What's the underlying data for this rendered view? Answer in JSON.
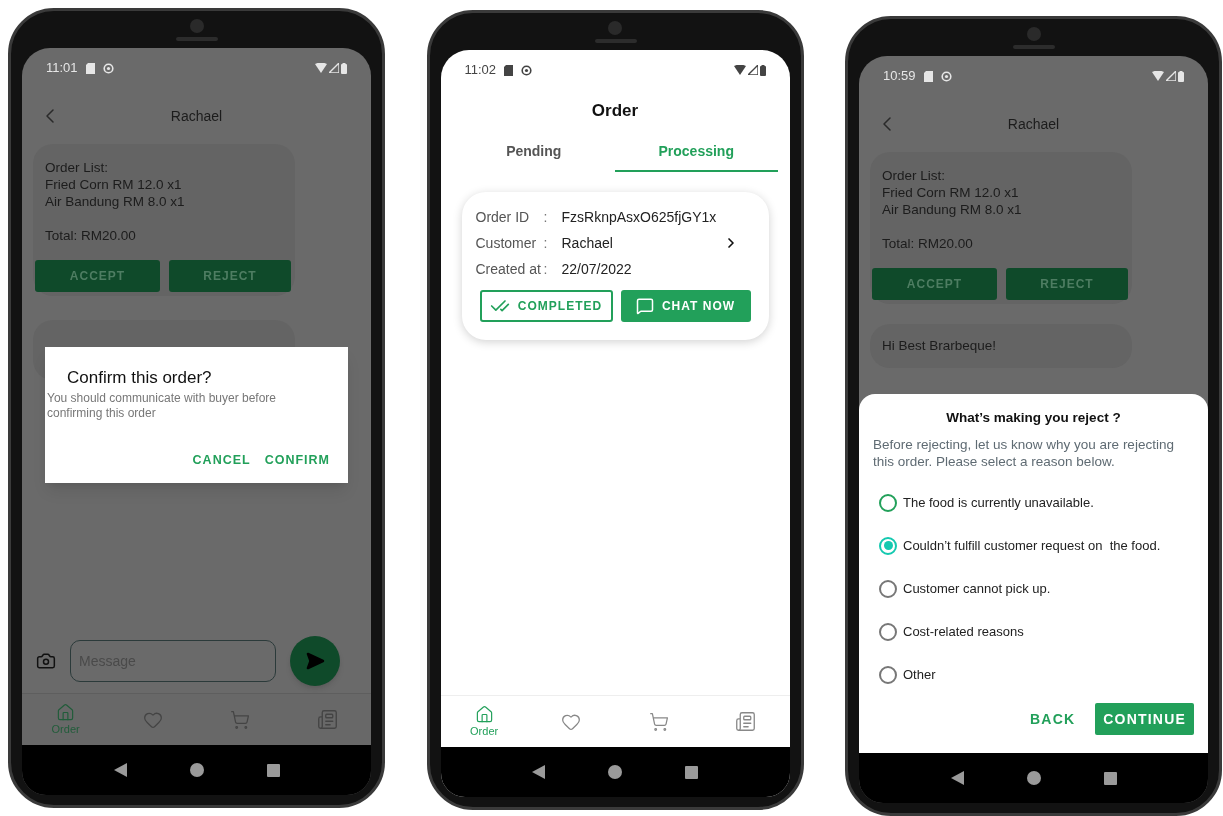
{
  "phones": [
    {
      "kind": "chat",
      "dimmed": true,
      "status_time": "11:01",
      "title": "Rachael",
      "order_card": {
        "lines": [
          "Order List:",
          "Fried Corn RM 12.0 x1",
          "Air Bandung RM 8.0 x1"
        ],
        "total": "Total: RM20.00",
        "buttons": [
          "ACCEPT",
          "REJECT"
        ]
      },
      "covered_bubble": true,
      "message_field": {
        "placeholder": "Message"
      },
      "bottom_nav": [
        {
          "label": "Order",
          "selected": true
        },
        {
          "selected": false
        },
        {
          "selected": false
        },
        {
          "selected": false
        }
      ],
      "dialog": {
        "kind": "confirm",
        "title": "Confirm this order?",
        "body": "You should communicate with buyer before confirming this order",
        "actions": [
          "CANCEL",
          "CONFIRM"
        ]
      }
    },
    {
      "kind": "orders",
      "dimmed": false,
      "status_time": "11:02",
      "title": "Order",
      "tabs": [
        {
          "label": "Pending",
          "selected": false
        },
        {
          "label": "Processing",
          "selected": true
        }
      ],
      "order": {
        "fields": [
          {
            "label": "Order ID",
            "separator": ":",
            "value": "FzsRknpAsxO625fjGY1x"
          },
          {
            "label": "Customer",
            "separator": ":",
            "value": "Rachael",
            "link": true
          },
          {
            "label": "Created at",
            "separator": ":",
            "value": "22/07/2022"
          }
        ],
        "completed_button": "COMPLETED",
        "chat_button": "CHAT NOW"
      },
      "bottom_nav": [
        {
          "label": "Order",
          "selected": true
        },
        {
          "selected": false
        },
        {
          "selected": false
        },
        {
          "selected": false
        }
      ]
    },
    {
      "kind": "chat",
      "dimmed": true,
      "status_time": "10:59",
      "title": "Rachael",
      "order_card": {
        "lines": [
          "Order List:",
          "Fried Corn RM 12.0 x1",
          "Air Bandung RM 8.0 x1"
        ],
        "total": "Total: RM20.00",
        "buttons": [
          "ACCEPT",
          "REJECT"
        ]
      },
      "bubble": "Hi Best Brarbeque!",
      "dialog": {
        "kind": "sheet",
        "title": "What’s making you reject ?",
        "body": "Before rejecting, let us know why you are rejecting this order. Please select a reason below.",
        "options": [
          {
            "label": "The food is currently unavailable.",
            "selected": false
          },
          {
            "label": "Couldn’t fulfill customer request on  the food.",
            "selected": true
          },
          {
            "label": "Customer cannot pick up.",
            "selected": false
          },
          {
            "label": "Cost-related reasons",
            "selected": false
          },
          {
            "label": "Other",
            "selected": false
          }
        ],
        "actions": [
          "BACK",
          "CONTINUE"
        ]
      }
    }
  ]
}
